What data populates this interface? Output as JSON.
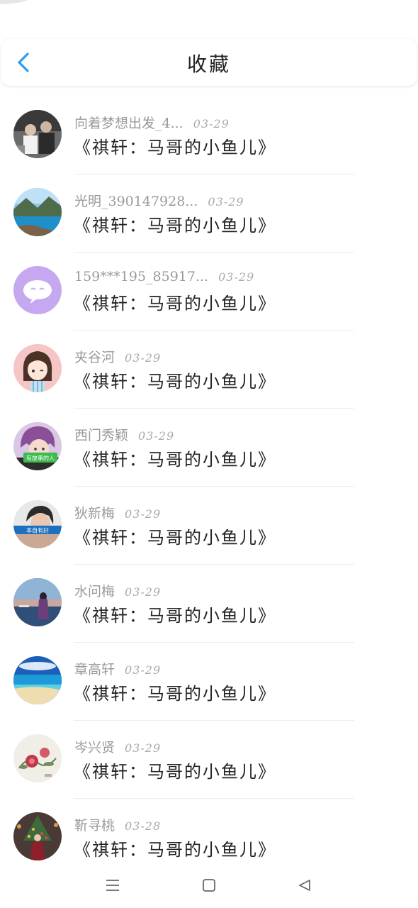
{
  "header": {
    "title": "收藏",
    "back_icon": "chevron-left-icon",
    "accent": "#2a9df4"
  },
  "favorites": [
    {
      "name": "向着梦想出发_4...",
      "date": "03-29",
      "subject": "《祺轩：马哥的小鱼儿》",
      "avatar": "photo-group-avatar"
    },
    {
      "name": "光明_390147928...",
      "date": "03-29",
      "subject": "《祺轩：马哥的小鱼儿》",
      "avatar": "lake-landscape-avatar"
    },
    {
      "name": "159***195_85917...",
      "date": "03-29",
      "subject": "《祺轩：马哥的小鱼儿》",
      "avatar": "default-chat-avatar"
    },
    {
      "name": "夹谷河",
      "date": "03-29",
      "subject": "《祺轩：马哥的小鱼儿》",
      "avatar": "cartoon-girl-avatar"
    },
    {
      "name": "西门秀颖",
      "date": "03-29",
      "subject": "《祺轩：马哥的小鱼儿》",
      "avatar": "anime-character-avatar",
      "avatar_text": "有故事的人"
    },
    {
      "name": "狄新梅",
      "date": "03-29",
      "subject": "《祺轩：马哥的小鱼儿》",
      "avatar": "portrait-avatar",
      "avatar_text": "本自有好"
    },
    {
      "name": "水问梅",
      "date": "03-29",
      "subject": "《祺轩：马哥的小鱼儿》",
      "avatar": "sunset-girl-avatar"
    },
    {
      "name": "章高轩",
      "date": "03-29",
      "subject": "《祺轩：马哥的小鱼儿》",
      "avatar": "beach-avatar"
    },
    {
      "name": "岑兴贤",
      "date": "03-29",
      "subject": "《祺轩：马哥的小鱼儿》",
      "avatar": "flower-painting-avatar"
    },
    {
      "name": "靳寻桃",
      "date": "03-28",
      "subject": "《祺轩：马哥的小鱼儿》",
      "avatar": "christmas-tree-avatar"
    }
  ],
  "navbar": {
    "menu_icon": "menu-icon",
    "home_icon": "home-square-icon",
    "back_icon": "back-triangle-icon"
  }
}
